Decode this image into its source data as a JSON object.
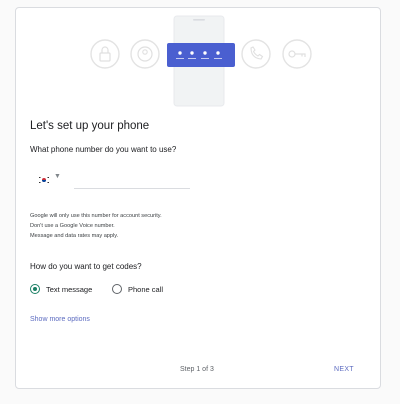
{
  "page": {
    "heading": "Let's set up your phone",
    "phone_question": "What phone number do you want to use?",
    "phone_input": {
      "value": "",
      "placeholder": ""
    },
    "country": {
      "flag_icon": "south-korea-flag-icon",
      "caret_icon": "dropdown-caret-icon"
    },
    "notes": [
      "Google will only use this number for account security.",
      "Don't use a Google Voice number.",
      "Message and data rates may apply."
    ],
    "codes_question": "How do you want to get codes?",
    "options": [
      {
        "label": "Text message",
        "selected": true
      },
      {
        "label": "Phone call",
        "selected": false
      }
    ],
    "more_options_link": "Show more options",
    "step": "Step 1 of 3",
    "next_label": "NEXT"
  },
  "illustration": {
    "icons": [
      "lock-icon",
      "person-icon",
      "password-dots-icon",
      "phone-icon",
      "key-icon"
    ]
  },
  "colors": {
    "accent": "#5c6bc0",
    "radio_selected": "#1a7f64",
    "text": "#202124",
    "border": "#dadce0"
  }
}
